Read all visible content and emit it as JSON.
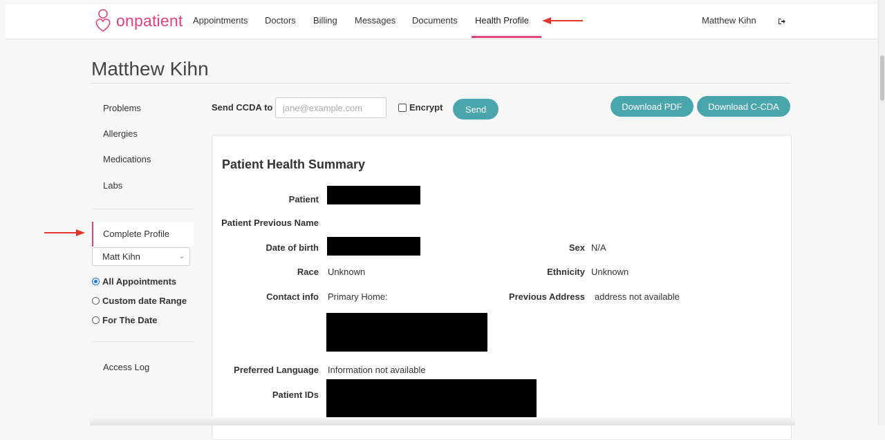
{
  "app": {
    "brand": "onpatient"
  },
  "nav": {
    "items": [
      {
        "label": "Appointments"
      },
      {
        "label": "Doctors"
      },
      {
        "label": "Billing"
      },
      {
        "label": "Messages"
      },
      {
        "label": "Documents"
      },
      {
        "label": "Health Profile",
        "active": true
      }
    ],
    "user_name": "Matthew Kihn",
    "logout_icon": "logout-icon"
  },
  "page": {
    "title": "Matthew Kihn"
  },
  "sidebar": {
    "sections": [
      {
        "label": "Problems"
      },
      {
        "label": "Allergies"
      },
      {
        "label": "Medications"
      },
      {
        "label": "Labs"
      }
    ],
    "complete_profile": "Complete Profile",
    "patient_select": {
      "value": "Matt Kihn"
    },
    "date_filters": [
      {
        "label": "All Appointments",
        "selected": true
      },
      {
        "label": "Custom date Range",
        "selected": false
      },
      {
        "label": "For The Date",
        "selected": false
      }
    ],
    "access_log": "Access Log"
  },
  "ccda": {
    "label": "Send CCDA to",
    "placeholder": "jane@example.com",
    "encrypt_label": "Encrypt",
    "send_label": "Send",
    "download_pdf": "Download PDF",
    "download_ccda": "Download C-CDA"
  },
  "summary": {
    "title": "Patient Health Summary",
    "patient_label": "Patient",
    "previous_name_label": "Patient Previous Name",
    "dob_label": "Date of birth",
    "sex_label": "Sex",
    "sex_value": "N/A",
    "race_label": "Race",
    "race_value": "Unknown",
    "ethnicity_label": "Ethnicity",
    "ethnicity_value": "Unknown",
    "contact_label": "Contact info",
    "contact_value": "Primary Home:",
    "previous_address_label": "Previous Address",
    "previous_address_value": "address not available",
    "language_label": "Preferred Language",
    "language_value": "Information not available",
    "patient_ids_label": "Patient IDs"
  },
  "colors": {
    "brand": "#e0427a",
    "button": "#4aa6ad",
    "annotation_arrow": "#e3362a"
  }
}
